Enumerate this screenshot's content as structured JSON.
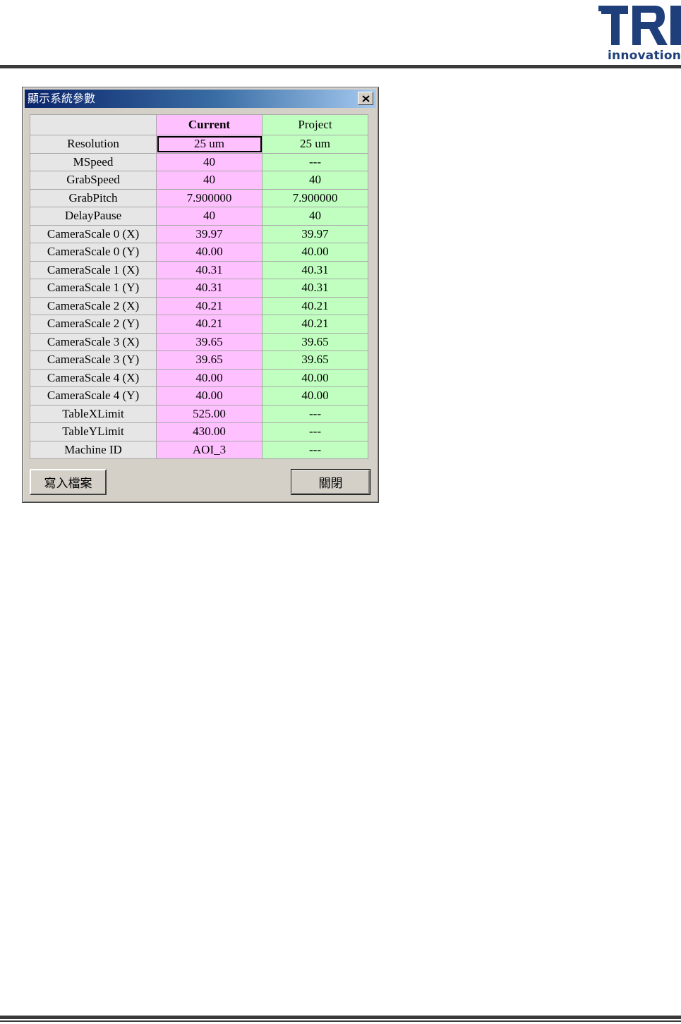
{
  "header": {
    "logo_letters": "TRI",
    "logo_word": "innovation",
    "brand_color": "#1f3f7a"
  },
  "dialog": {
    "title": "顯示系統參數",
    "close_icon": "close-icon",
    "columns": [
      "",
      "Current",
      "Project"
    ],
    "rows": [
      {
        "label": "Resolution",
        "current": "25 um",
        "project": "25 um"
      },
      {
        "label": "MSpeed",
        "current": "40",
        "project": "---"
      },
      {
        "label": "GrabSpeed",
        "current": "40",
        "project": "40"
      },
      {
        "label": "GrabPitch",
        "current": "7.900000",
        "project": "7.900000"
      },
      {
        "label": "DelayPause",
        "current": "40",
        "project": "40"
      },
      {
        "label": "CameraScale 0 (X)",
        "current": "39.97",
        "project": "39.97"
      },
      {
        "label": "CameraScale 0 (Y)",
        "current": "40.00",
        "project": "40.00"
      },
      {
        "label": "CameraScale 1 (X)",
        "current": "40.31",
        "project": "40.31"
      },
      {
        "label": "CameraScale 1 (Y)",
        "current": "40.31",
        "project": "40.31"
      },
      {
        "label": "CameraScale 2 (X)",
        "current": "40.21",
        "project": "40.21"
      },
      {
        "label": "CameraScale 2 (Y)",
        "current": "40.21",
        "project": "40.21"
      },
      {
        "label": "CameraScale 3 (X)",
        "current": "39.65",
        "project": "39.65"
      },
      {
        "label": "CameraScale 3 (Y)",
        "current": "39.65",
        "project": "39.65"
      },
      {
        "label": "CameraScale 4 (X)",
        "current": "40.00",
        "project": "40.00"
      },
      {
        "label": "CameraScale 4 (Y)",
        "current": "40.00",
        "project": "40.00"
      },
      {
        "label": "TableXLimit",
        "current": "525.00",
        "project": "---"
      },
      {
        "label": "TableYLimit",
        "current": "430.00",
        "project": "---"
      },
      {
        "label": "Machine ID",
        "current": "AOI_3",
        "project": "---"
      }
    ],
    "colors": {
      "current_bg": "#ffc0ff",
      "project_bg": "#c0ffc0",
      "label_bg": "#e6e6e6",
      "title_gradient_start": "#0a246a",
      "title_gradient_end": "#a6caf0"
    },
    "buttons": {
      "write_file": "寫入檔案",
      "close": "關閉"
    }
  }
}
